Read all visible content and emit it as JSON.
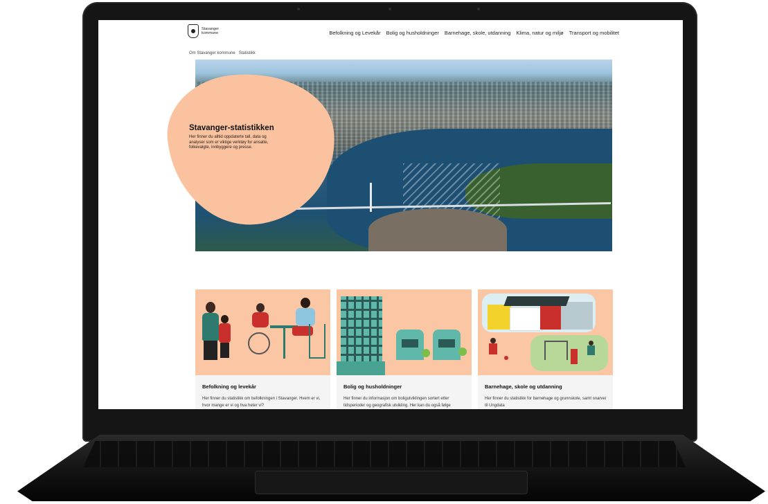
{
  "header": {
    "logo_line1": "Stavanger",
    "logo_line2": "kommune",
    "nav": [
      "Befolkning og Levekår",
      "Bolig og husholdninger",
      "Barnehage, skole, utdanning",
      "Klima, natur og miljø",
      "Transport og mobilitet"
    ]
  },
  "breadcrumb": [
    "Om Stavanger kommune",
    "Statistikk"
  ],
  "hero": {
    "title": "Stavanger-statistikken",
    "lead": "Her finner du alltid oppdaterte tall, data og analyser som er viktige verktøy for ansatte, folkevalgte, innbyggere og presse."
  },
  "cards": [
    {
      "title": "Befolkning og levekår",
      "desc": "Her finner du statistikk om befolkningen i Stavanger. Hvem er vi, hvor mange er vi og hva heter vi?"
    },
    {
      "title": "Bolig og husholdninger",
      "desc": "Her finner du informasjon om boligutviklingen sortert etter tidsperioder og geografisk utvikling. Her kan du også følge"
    },
    {
      "title": "Barnehage, skole og utdanning",
      "desc": "Her finner du statistikk for barnehage og grunnskole, samt snarvei til Ungdata"
    }
  ],
  "colors": {
    "accent_peach": "#fbc29f",
    "card_bg": "#f4f4f4",
    "laptop_body": "#151515"
  }
}
